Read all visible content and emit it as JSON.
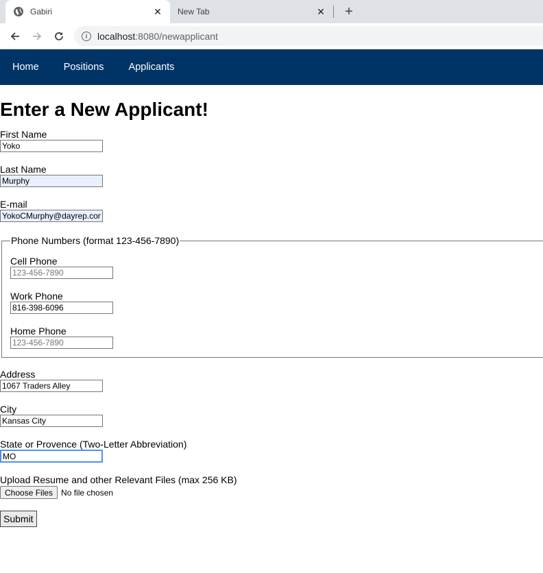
{
  "browser": {
    "tabs": [
      {
        "title": "Gabiri",
        "icon": "globe-icon"
      },
      {
        "title": "New Tab"
      }
    ],
    "url_host": "localhost",
    "url_path": ":8080/newapplicant"
  },
  "nav": {
    "items": [
      {
        "label": "Home"
      },
      {
        "label": "Positions"
      },
      {
        "label": "Applicants"
      }
    ],
    "background": "#003366"
  },
  "page": {
    "title": "Enter a New Applicant!"
  },
  "form": {
    "first_name": {
      "label": "First Name",
      "value": "Yoko"
    },
    "last_name": {
      "label": "Last Name",
      "value": "Murphy"
    },
    "email": {
      "label": "E-mail",
      "value": "YokoCMurphy@dayrep.com"
    },
    "phones": {
      "legend": "Phone Numbers (format 123-456-7890)",
      "cell": {
        "label": "Cell Phone",
        "value": "",
        "placeholder": "123-456-7890"
      },
      "work": {
        "label": "Work Phone",
        "value": "816-398-6096",
        "placeholder": "123-456-7890"
      },
      "home": {
        "label": "Home Phone",
        "value": "",
        "placeholder": "123-456-7890"
      }
    },
    "address": {
      "label": "Address",
      "value": "1067 Traders Alley"
    },
    "city": {
      "label": "City",
      "value": "Kansas City"
    },
    "state": {
      "label": "State or Provence (Two-Letter Abbreviation)",
      "value": "MO"
    },
    "upload": {
      "label": "Upload Resume and other Relevant Files (max 256 KB)",
      "button": "Choose Files",
      "status": "No file chosen"
    },
    "submit_label": "Submit"
  }
}
